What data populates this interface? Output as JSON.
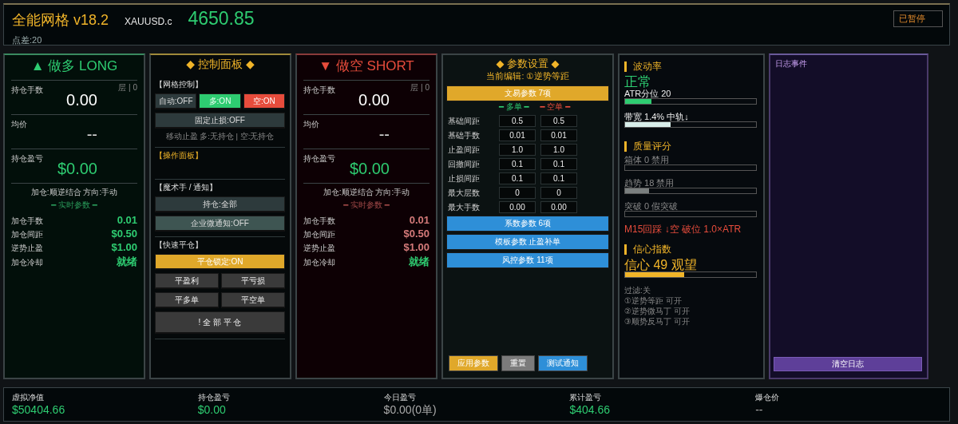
{
  "header": {
    "title": "全能网格 v18.2",
    "symbol": "XAUUSD.c",
    "price": "4650.85",
    "spread": "点差:20",
    "status": "已暂停"
  },
  "sides": [
    {
      "kind": "long",
      "title": "▲ 做多 LONG",
      "layer": "层 | 0",
      "lots_label": "持仓手数",
      "lots": "0.00",
      "avg_label": "均价",
      "avg": "--",
      "pnl_label": "持仓盈亏",
      "pnl": "$0.00",
      "mode": "加仓:顺逆结合  方向:手动",
      "section": "━ 实时参数 ━",
      "params": [
        {
          "label": "加仓手数",
          "value": "0.01",
          "color": "#2ecc71"
        },
        {
          "label": "加仓间距",
          "value": "$0.50",
          "color": "#2ecc71"
        },
        {
          "label": "逆势止盈",
          "value": "$1.00",
          "color": "#2ecc71"
        },
        {
          "label": "加仓冷却",
          "value": "就绪",
          "color": "#2ecc71"
        }
      ]
    },
    {
      "kind": "short",
      "title": "▼ 做空 SHORT",
      "layer": "层 | 0",
      "lots_label": "持仓手数",
      "lots": "0.00",
      "avg_label": "均价",
      "avg": "--",
      "pnl_label": "持仓盈亏",
      "pnl": "$0.00",
      "mode": "加仓:顺逆结合  方向:手动",
      "section": "━ 实时参数 ━",
      "params": [
        {
          "label": "加仓手数",
          "value": "0.01",
          "color": "#d47a7a"
        },
        {
          "label": "加仓间距",
          "value": "$0.50",
          "color": "#d47a7a"
        },
        {
          "label": "逆势止盈",
          "value": "$1.00",
          "color": "#d47a7a"
        },
        {
          "label": "加仓冷却",
          "value": "就绪",
          "color": "#2ecc71"
        }
      ]
    }
  ],
  "control": {
    "title": "◆ 控制面板 ◆",
    "sections": [
      {
        "title": "【网格控制】",
        "highlight": false,
        "groups": [
          {
            "buttons": [
              {
                "label": "自动:OFF",
                "kind": "off"
              },
              {
                "label": "多:ON",
                "kind": "green"
              },
              {
                "label": "空:ON",
                "kind": "red"
              }
            ]
          },
          {
            "buttons": [
              {
                "label": "固定止损:OFF",
                "kind": "off"
              }
            ]
          }
        ],
        "note": "移动止盈  多:无持仓 | 空:无持仓"
      },
      {
        "title": "【操作面板】",
        "highlight": true
      },
      {
        "title": "【魔术手 / 通知】",
        "highlight": false,
        "groups": [
          {
            "buttons": [
              {
                "label": "持仓:全部",
                "kind": "off"
              }
            ]
          },
          {
            "buttons": [
              {
                "label": "企业微通知:OFF",
                "kind": "teal"
              }
            ]
          }
        ]
      },
      {
        "title": "【快速平仓】",
        "highlight": false,
        "groups": [
          {
            "buttons": [
              {
                "label": "平仓锁定:ON",
                "kind": "yellow"
              }
            ]
          },
          {
            "buttons": [
              {
                "label": "平盈利",
                "kind": "dark"
              },
              {
                "label": "平亏损",
                "kind": "dark"
              }
            ]
          },
          {
            "buttons": [
              {
                "label": "平多单",
                "kind": "dark"
              },
              {
                "label": "平空单",
                "kind": "dark"
              }
            ]
          },
          {
            "buttons": [
              {
                "label": "! 全 部 平 仓",
                "kind": "big"
              }
            ]
          }
        ]
      }
    ]
  },
  "params": {
    "title": "◆ 参数设置 ◆",
    "editing": "当前编辑: ①逆势等距",
    "trade_button": "文易参数   7项",
    "long_header": "━ 多单 ━",
    "short_header": "━ 空单 ━",
    "rows": [
      {
        "label": "基础间距",
        "long": "0.5",
        "short": "0.5"
      },
      {
        "label": "基础手数",
        "long": "0.01",
        "short": "0.01"
      },
      {
        "label": "止盈间距",
        "long": "1.0",
        "short": "1.0"
      },
      {
        "label": "回撤间距",
        "long": "0.1",
        "short": "0.1"
      },
      {
        "label": "止损间距",
        "long": "0.1",
        "short": "0.1"
      },
      {
        "label": "最大层数",
        "long": "0",
        "short": "0"
      },
      {
        "label": "最大手数",
        "long": "0.00",
        "short": "0.00"
      }
    ],
    "groups": [
      "系数参数   6项",
      "模板参数   止盈补单",
      "风控参数   11项"
    ],
    "actions": [
      {
        "label": "应用参数",
        "kind": "yellow"
      },
      {
        "label": "重置",
        "kind": "gray"
      },
      {
        "label": "测试通知",
        "kind": "blue"
      }
    ]
  },
  "status": {
    "volatility_title": "波动率",
    "volatility_state": "正常",
    "volatility_meters": [
      {
        "label": "ATR分位 20",
        "level": 0.2,
        "color": "#2ecc71"
      },
      {
        "label": "带宽 1.4% 中轨↓",
        "level": 0.35,
        "color": "#d8eeea"
      }
    ],
    "quality_title": "质量评分",
    "quality_meters": [
      {
        "label": "箱体  0 禁用"
      },
      {
        "label": "趋势  18 禁用",
        "level": 0.18
      },
      {
        "label": "突破  0 假突破"
      }
    ],
    "alert": "M15回踩  ↓空 破位 1.0×ATR",
    "confidence_title": "信心指数",
    "confidence": {
      "label": "信心   49 观望",
      "level": 0.45,
      "color": "#f0b429"
    },
    "filter": "过滤:关",
    "filter_items": [
      "①逆势等距   可开",
      "②逆势微马丁   可开",
      "③顺势反马丁   可开"
    ]
  },
  "log": {
    "title": "日志事件",
    "clear_button": "清空日志"
  },
  "footer": [
    {
      "label": "虚拟净值",
      "value": "$50404.66",
      "color": "#2ecc71"
    },
    {
      "label": "持仓盈亏",
      "value": "$0.00",
      "color": "#2ecc71"
    },
    {
      "label": "今日盈亏",
      "value": "$0.00(0单)",
      "color": "#aaaaaa"
    },
    {
      "label": "累计盈亏",
      "value": "$404.66",
      "color": "#2ecc71"
    },
    {
      "label": "爆仓价",
      "value": "--",
      "color": "#aaaaaa"
    }
  ]
}
